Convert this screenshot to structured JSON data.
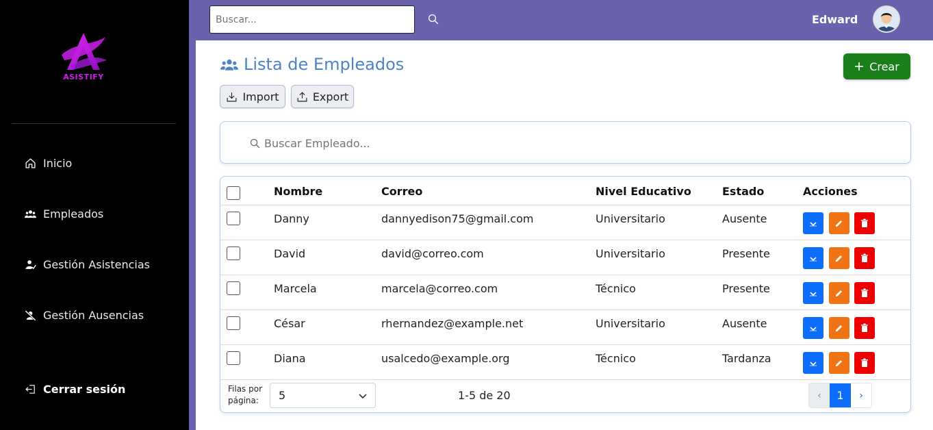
{
  "brand": {
    "name": "ASISTIFY",
    "color": "#d01be8"
  },
  "sidebar": {
    "items": [
      {
        "label": "Inicio",
        "icon": "home-icon"
      },
      {
        "label": "Empleados",
        "icon": "users-icon"
      },
      {
        "label": "Gestión Asistencias",
        "icon": "user-check-icon"
      },
      {
        "label": "Gestión Ausencias",
        "icon": "user-slash-icon"
      }
    ],
    "logout": {
      "label": "Cerrar sesión",
      "icon": "logout-icon"
    }
  },
  "topbar": {
    "search_placeholder": "Buscar...",
    "user_name": "Edward",
    "color": "#6b62ae"
  },
  "main": {
    "title": "Lista de Empleados",
    "create_label": "Crear",
    "import_label": "Import",
    "export_label": "Export",
    "search_placeholder": "Buscar Empleado..."
  },
  "table": {
    "columns": [
      "Nombre",
      "Correo",
      "Nivel Educativo",
      "Estado",
      "Acciones"
    ],
    "rows": [
      {
        "nombre": "Danny",
        "correo": "dannyedison75@gmail.com",
        "nivel": "Universitario",
        "estado": "Ausente"
      },
      {
        "nombre": "David",
        "correo": "david@correo.com",
        "nivel": "Universitario",
        "estado": "Presente"
      },
      {
        "nombre": "Marcela",
        "correo": "marcela@correo.com",
        "nivel": "Técnico",
        "estado": "Presente"
      },
      {
        "nombre": "César",
        "correo": "rhernandez@example.net",
        "nivel": "Universitario",
        "estado": "Ausente"
      },
      {
        "nombre": "Diana",
        "correo": "usalcedo@example.org",
        "nivel": "Técnico",
        "estado": "Tardanza"
      }
    ]
  },
  "pagination": {
    "rows_per_page_label": "Filas por página:",
    "rows_per_page": "5",
    "range": "1-5 de 20",
    "prev": "‹",
    "current_page": "1",
    "next": "›"
  }
}
